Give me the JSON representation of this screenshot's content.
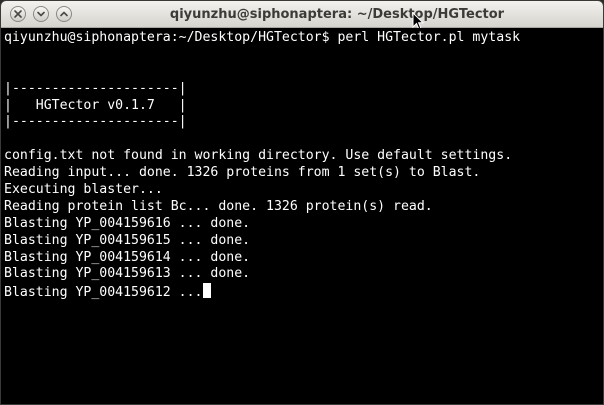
{
  "window": {
    "title": "qiyunzhu@siphonaptera: ~/Desktop/HGTector"
  },
  "icons": {
    "close": "close-icon",
    "minimize": "minimize-icon",
    "maximize": "maximize-icon",
    "pointer": "mouse-pointer-icon"
  },
  "terminal": {
    "lines": [
      "qiyunzhu@siphonaptera:~/Desktop/HGTector$ perl HGTector.pl mytask",
      "",
      "",
      "|---------------------|",
      "|   HGTector v0.1.7   |",
      "|---------------------|",
      "",
      "config.txt not found in working directory. Use default settings.",
      "Reading input... done. 1326 proteins from 1 set(s) to Blast.",
      "Executing blaster...",
      "Reading protein list Bc... done. 1326 protein(s) read.",
      "Blasting YP_004159616 ... done.",
      "Blasting YP_004159615 ... done.",
      "Blasting YP_004159614 ... done.",
      "Blasting YP_004159613 ... done.",
      "Blasting YP_004159612 ..."
    ]
  },
  "colors": {
    "terminal_background": "#000000",
    "terminal_text": "#ffffff",
    "titlebar": "#e3e1dc",
    "title_text": "#3c3b37"
  }
}
